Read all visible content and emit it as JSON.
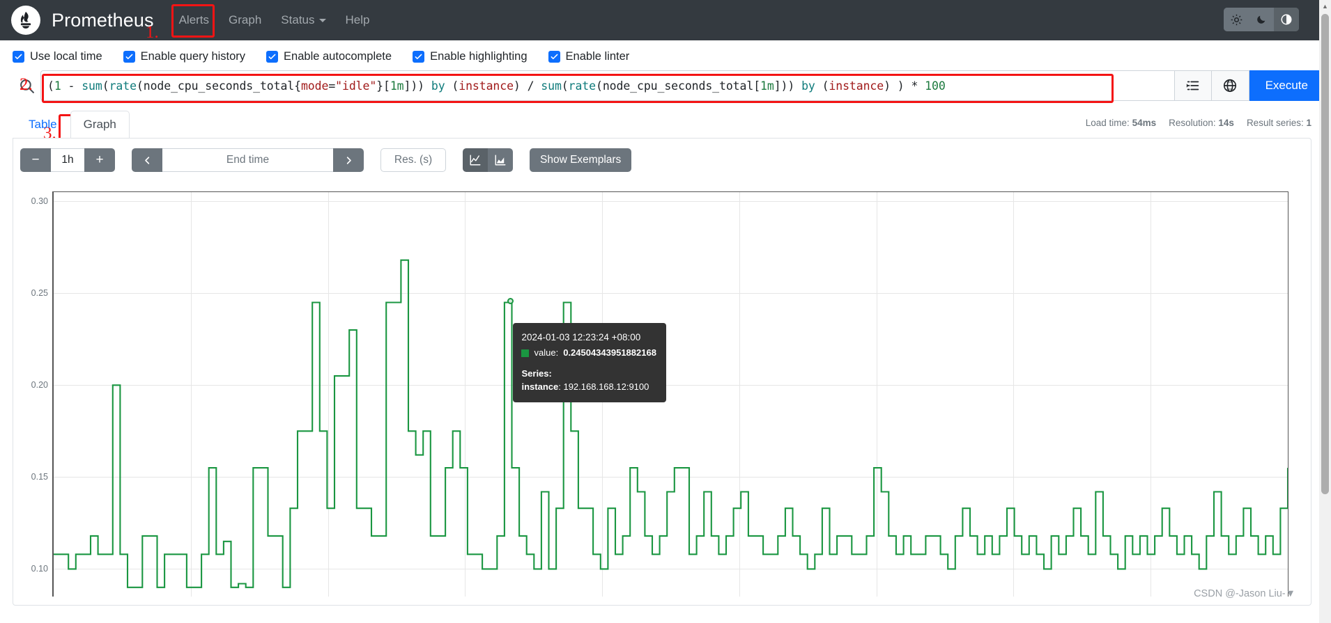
{
  "navbar": {
    "brand": "Prometheus",
    "logo_icon": "prometheus-torch-icon",
    "links": [
      {
        "label": "Alerts",
        "name": "alerts"
      },
      {
        "label": "Graph",
        "name": "graph"
      },
      {
        "label": "Status",
        "name": "status",
        "caret": true
      },
      {
        "label": "Help",
        "name": "help"
      }
    ],
    "theme_buttons": [
      {
        "icon": "sun-icon",
        "glyph": "⚙",
        "active": false
      },
      {
        "icon": "moon-icon",
        "glyph": "☾",
        "active": false
      },
      {
        "icon": "auto-contrast-icon",
        "glyph": "◑",
        "active": true
      }
    ]
  },
  "options": [
    {
      "label": "Use local time",
      "checked": true,
      "name": "use-local-time"
    },
    {
      "label": "Enable query history",
      "checked": true,
      "name": "enable-query-history"
    },
    {
      "label": "Enable autocomplete",
      "checked": true,
      "name": "enable-autocomplete"
    },
    {
      "label": "Enable highlighting",
      "checked": true,
      "name": "enable-highlighting"
    },
    {
      "label": "Enable linter",
      "checked": true,
      "name": "enable-linter"
    }
  ],
  "query": {
    "search_icon": "search-icon",
    "expression": "(1 - sum(rate(node_cpu_seconds_total{mode=\"idle\"}[1m])) by (instance) / sum(rate(node_cpu_seconds_total[1m])) by (instance) ) * 100",
    "metrics_explorer_icon": "metrics-explorer-icon",
    "globe_icon": "globe-icon",
    "execute_label": "Execute"
  },
  "annotations": [
    {
      "num": "1.",
      "target": "graph-nav-link"
    },
    {
      "num": "2.",
      "target": "query-input"
    },
    {
      "num": "3.",
      "target": "graph-tab"
    }
  ],
  "tabs": [
    {
      "label": "Table",
      "active": false,
      "name": "table"
    },
    {
      "label": "Graph",
      "active": true,
      "name": "graph"
    }
  ],
  "stats": {
    "load_time_label": "Load time:",
    "load_time_value": "54ms",
    "resolution_label": "Resolution:",
    "resolution_value": "14s",
    "result_series_label": "Result series:",
    "result_series_value": "1"
  },
  "controls": {
    "decrease_range": "−",
    "range_value": "1h",
    "increase_range": "+",
    "prev_icon": "chevron-left-icon",
    "end_time_placeholder": "End time",
    "next_icon": "chevron-right-icon",
    "resolution_placeholder": "Res. (s)",
    "line_chart_icon": "line-chart-icon",
    "stacked_chart_icon": "stacked-area-chart-icon",
    "show_exemplars_label": "Show Exemplars"
  },
  "tooltip": {
    "time": "2024-01-03 12:23:24 +08:00",
    "value_label": "value:",
    "value": "0.24504343951882168",
    "series_label": "Series:",
    "instance_label": "instance",
    "instance_value": "192.168.168.12:9100",
    "swatch_color": "#1a9641"
  },
  "watermark": "CSDN @-Jason Liu-▼",
  "chart_data": {
    "type": "line",
    "title": "",
    "xlabel": "",
    "ylabel": "",
    "ylim": [
      0.085,
      0.305
    ],
    "ytick_labels": [
      "0.30",
      "0.25",
      "0.20",
      "0.15",
      "0.10"
    ],
    "ytick_values": [
      0.3,
      0.25,
      0.2,
      0.15,
      0.1
    ],
    "grid": true,
    "legend": "none",
    "series": [
      {
        "name": "instance=\"192.168.168.12:9100\"",
        "color": "#1a9641",
        "step": true,
        "values": [
          0.108,
          0.108,
          0.1,
          0.108,
          0.108,
          0.118,
          0.108,
          0.108,
          0.2,
          0.108,
          0.09,
          0.09,
          0.118,
          0.118,
          0.09,
          0.108,
          0.108,
          0.108,
          0.09,
          0.09,
          0.108,
          0.155,
          0.108,
          0.115,
          0.09,
          0.092,
          0.09,
          0.155,
          0.155,
          0.118,
          0.118,
          0.09,
          0.133,
          0.175,
          0.175,
          0.245,
          0.175,
          0.133,
          0.205,
          0.205,
          0.23,
          0.133,
          0.133,
          0.118,
          0.118,
          0.245,
          0.245,
          0.268,
          0.175,
          0.162,
          0.175,
          0.118,
          0.118,
          0.155,
          0.175,
          0.155,
          0.108,
          0.108,
          0.1,
          0.1,
          0.118,
          0.245,
          0.155,
          0.118,
          0.108,
          0.1,
          0.142,
          0.1,
          0.133,
          0.245,
          0.175,
          0.133,
          0.133,
          0.108,
          0.1,
          0.133,
          0.108,
          0.118,
          0.155,
          0.142,
          0.118,
          0.108,
          0.118,
          0.142,
          0.155,
          0.155,
          0.108,
          0.118,
          0.142,
          0.118,
          0.108,
          0.118,
          0.133,
          0.142,
          0.118,
          0.118,
          0.108,
          0.108,
          0.118,
          0.133,
          0.118,
          0.108,
          0.1,
          0.108,
          0.133,
          0.108,
          0.118,
          0.118,
          0.108,
          0.108,
          0.118,
          0.155,
          0.142,
          0.118,
          0.108,
          0.118,
          0.108,
          0.108,
          0.118,
          0.118,
          0.108,
          0.1,
          0.118,
          0.133,
          0.118,
          0.108,
          0.118,
          0.108,
          0.118,
          0.133,
          0.118,
          0.108,
          0.118,
          0.108,
          0.1,
          0.118,
          0.108,
          0.118,
          0.133,
          0.118,
          0.108,
          0.142,
          0.118,
          0.108,
          0.1,
          0.118,
          0.108,
          0.118,
          0.108,
          0.118,
          0.133,
          0.118,
          0.108,
          0.118,
          0.108,
          0.1,
          0.118,
          0.142,
          0.118,
          0.108,
          0.118,
          0.133,
          0.118,
          0.108,
          0.118,
          0.108,
          0.133,
          0.155
        ]
      }
    ],
    "hover_point": {
      "index": 62,
      "value": 0.24504343951882168,
      "time": "2024-01-03 12:23:24 +08:00"
    }
  }
}
